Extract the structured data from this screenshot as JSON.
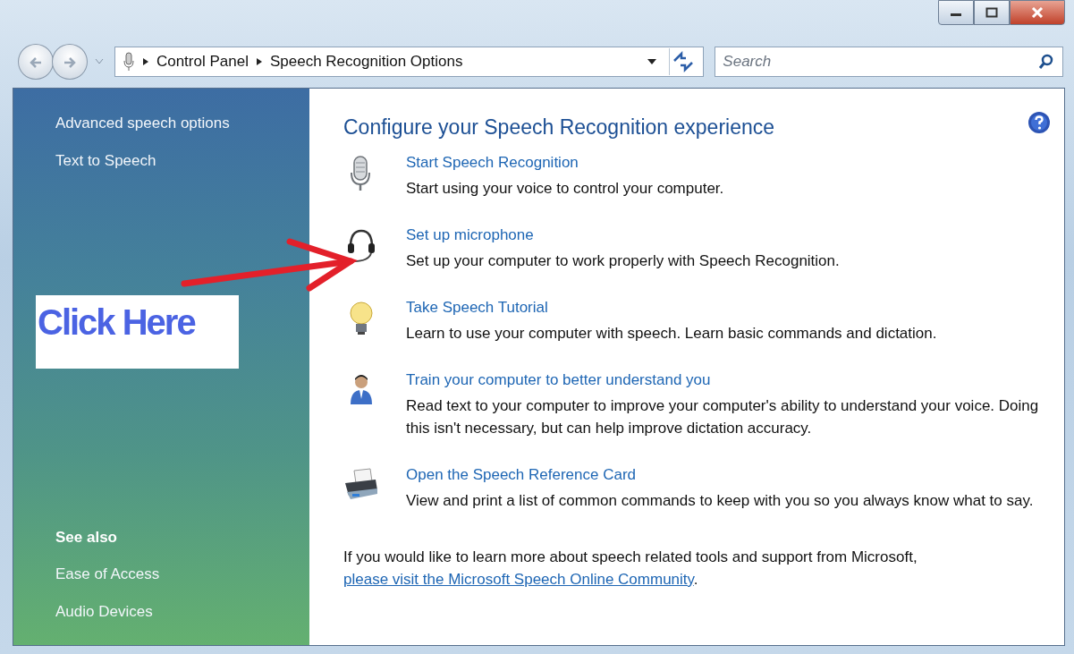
{
  "address_bar": {
    "breadcrumbs": [
      "Control Panel",
      "Speech Recognition Options"
    ]
  },
  "search": {
    "placeholder": "Search"
  },
  "sidebar": {
    "tasks": [
      "Advanced speech options",
      "Text to Speech"
    ],
    "see_also": {
      "heading": "See also",
      "items": [
        "Ease of Access",
        "Audio Devices"
      ]
    }
  },
  "main": {
    "title": "Configure your Speech Recognition experience",
    "items": [
      {
        "kind": "microphone",
        "link": "Start Speech Recognition",
        "description": "Start using your voice to control your computer."
      },
      {
        "kind": "headset",
        "link": "Set up microphone",
        "description": "Set up your computer to work properly with Speech Recognition."
      },
      {
        "kind": "bulb",
        "link": "Take Speech Tutorial",
        "description": "Learn to use your computer with speech.  Learn basic commands and dictation."
      },
      {
        "kind": "person",
        "link": "Train your computer to better understand you",
        "description": "Read text to your computer to improve your computer's ability to understand your voice.  Doing this isn't necessary, but can help improve dictation accuracy."
      },
      {
        "kind": "printer",
        "link": "Open the Speech Reference Card",
        "description": "View and print a list of common commands to keep with you so you always know what to say."
      }
    ],
    "footer": {
      "text": "If you would like to learn more about speech related tools and support from Microsoft,",
      "link": "please visit the Microsoft Speech Online Community",
      "end": "."
    }
  },
  "annotation": {
    "label": "Click Here"
  }
}
